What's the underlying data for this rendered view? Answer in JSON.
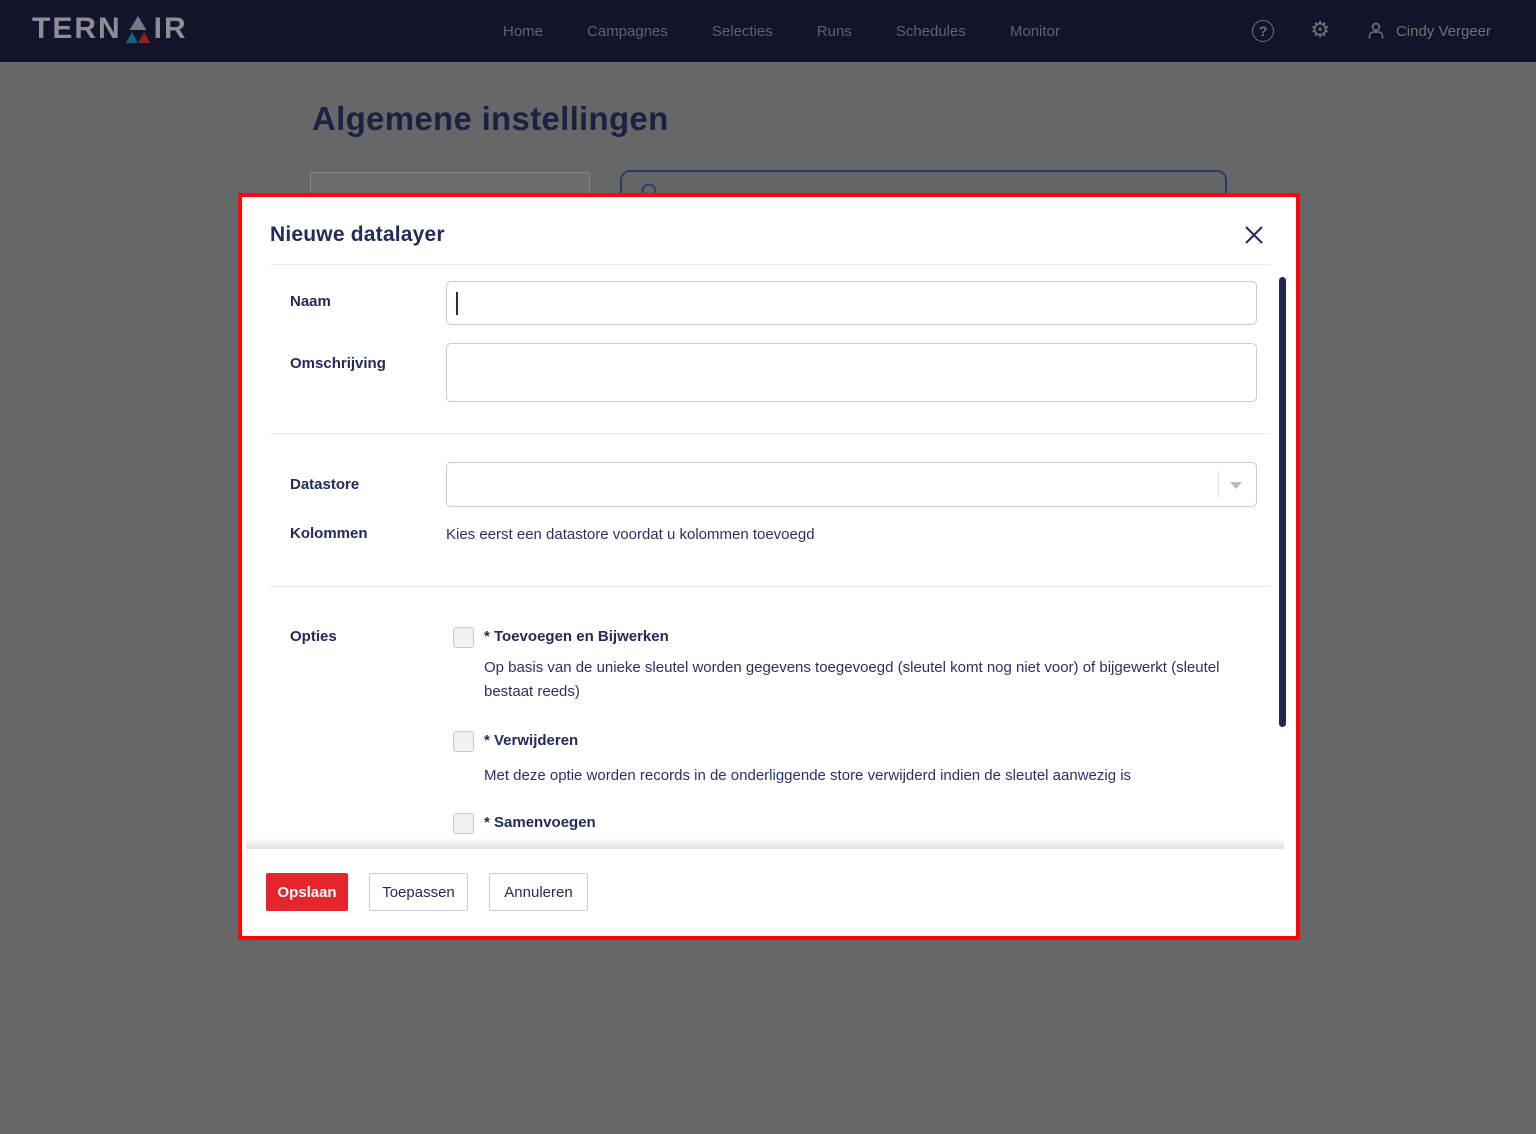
{
  "header": {
    "logo": {
      "text_left": "TERN",
      "text_right": "IR"
    },
    "nav": [
      {
        "label": "Home"
      },
      {
        "label": "Campagnes"
      },
      {
        "label": "Selecties"
      },
      {
        "label": "Runs"
      },
      {
        "label": "Schedules"
      },
      {
        "label": "Monitor"
      }
    ],
    "icons": {
      "help_glyph": "?",
      "settings_glyph": "⚙"
    },
    "user_name": "Cindy Vergeer"
  },
  "page": {
    "title": "Algemene instellingen"
  },
  "modal": {
    "title": "Nieuwe datalayer",
    "fields": {
      "naam_label": "Naam",
      "naam_value": "",
      "omschrijving_label": "Omschrijving",
      "omschrijving_value": "",
      "datastore_label": "Datastore",
      "datastore_value": "",
      "kolommen_label": "Kolommen",
      "kolommen_hint": "Kies eerst een datastore voordat u kolommen toevoegd",
      "opties_label": "Opties"
    },
    "options": [
      {
        "label": "* Toevoegen en Bijwerken",
        "description": "Op basis van de unieke sleutel worden gegevens toegevoegd (sleutel komt nog niet voor) of bijgewerkt (sleutel bestaat reeds)",
        "checked": false
      },
      {
        "label": "* Verwijderen",
        "description": "Met deze optie worden records in de onderliggende store verwijderd indien de sleutel aanwezig is",
        "checked": false
      },
      {
        "label": "* Samenvoegen",
        "description": "",
        "checked": false
      }
    ],
    "buttons": {
      "save": "Opslaan",
      "apply": "Toepassen",
      "cancel": "Annuleren"
    }
  },
  "colors": {
    "brand_navy": "#232a5c",
    "accent_red": "#e5252b",
    "modal_border_red": "#ff0505",
    "nav_bg": "#12152a",
    "overlay_gray": "#666769"
  }
}
